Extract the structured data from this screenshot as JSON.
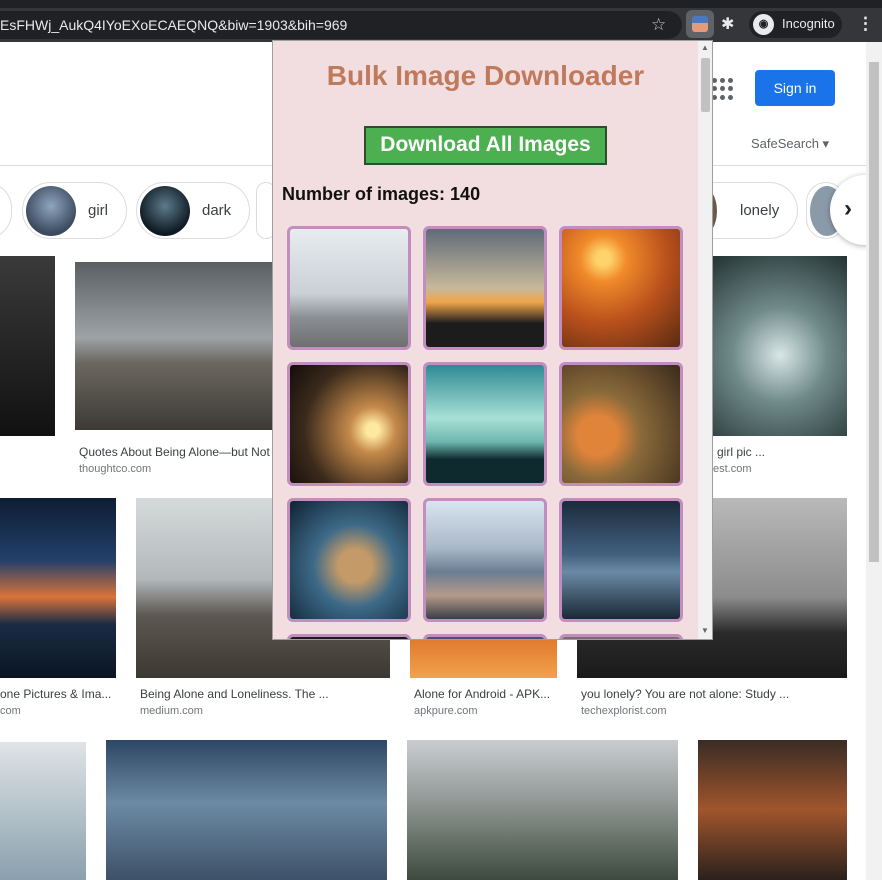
{
  "browser": {
    "url": "EsFHWj_AukQ4IYoEXoECAEQNQ&biw=1903&bih=969",
    "incognito_label": "Incognito"
  },
  "google": {
    "sign_in": "Sign in",
    "safesearch": "SafeSearch",
    "chips": [
      {
        "label": "girl"
      },
      {
        "label": "dark"
      },
      {
        "label": "lonely"
      }
    ],
    "results": [
      {
        "caption": "Quotes About Being Alone—but Not",
        "source": "thoughtco.com"
      },
      {
        "caption": "girl pic ...",
        "source": "est.com"
      },
      {
        "caption": "one Pictures & Ima...",
        "source": "com"
      },
      {
        "caption": "Being Alone and Loneliness. The ...",
        "source": "medium.com"
      },
      {
        "caption": "Alone for Android - APK...",
        "source": "apkpure.com"
      },
      {
        "caption": "you lonely? You are not alone: Study ...",
        "source": "techexplorist.com"
      }
    ]
  },
  "popup": {
    "title": "Bulk Image Downloader",
    "download_button": "Download All Images",
    "count_label": "Number of images:",
    "count_value": "140"
  },
  "colors": {
    "popup_bg": "#f2dde0",
    "title": "#bf7a5c",
    "download_button": "#4caf50",
    "tile_border": "#c28dbf",
    "sign_in": "#1a73e8"
  }
}
